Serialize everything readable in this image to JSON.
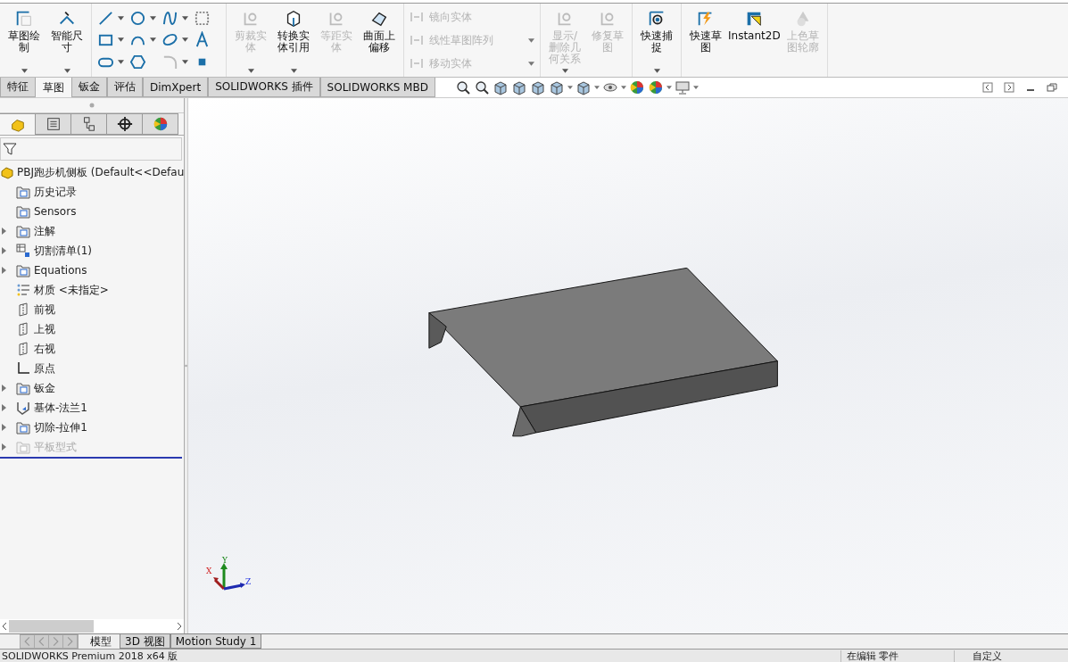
{
  "ribbon": {
    "groups": [
      {
        "kind": "big",
        "items": [
          {
            "label": "草图绘制",
            "disabled": false,
            "has_menu": true
          },
          {
            "label": "智能尺寸",
            "disabled": false,
            "has_menu": true
          }
        ]
      },
      {
        "kind": "grid",
        "items": [
          {
            "has_menu": true
          },
          {
            "has_menu": true
          },
          {
            "has_menu": true
          },
          {
            "has_menu": false
          },
          {
            "has_menu": true
          },
          {
            "has_menu": true
          },
          {
            "has_menu": true
          },
          {
            "has_menu": false
          },
          {
            "has_menu": true
          },
          {
            "has_menu": false
          },
          {
            "has_menu": true
          },
          {
            "has_menu": false
          }
        ]
      },
      {
        "kind": "big",
        "items": [
          {
            "label": "剪裁实体",
            "disabled": true,
            "has_menu": true
          },
          {
            "label": "转换实体引用",
            "disabled": false,
            "has_menu": true
          },
          {
            "label": "等距实体",
            "disabled": true,
            "has_menu": false
          },
          {
            "label": "曲面上偏移",
            "disabled": false,
            "has_menu": false
          }
        ]
      },
      {
        "kind": "list",
        "items": [
          {
            "label": "镜向实体",
            "disabled": true,
            "has_menu": false
          },
          {
            "label": "线性草图阵列",
            "disabled": true,
            "has_menu": true
          },
          {
            "label": "移动实体",
            "disabled": true,
            "has_menu": true
          }
        ]
      },
      {
        "kind": "big",
        "items": [
          {
            "label": "显示/删除几何关系",
            "disabled": true,
            "has_menu": true
          },
          {
            "label": "修复草图",
            "disabled": true,
            "has_menu": false
          }
        ]
      },
      {
        "kind": "big",
        "items": [
          {
            "label": "快速捕捉",
            "disabled": false,
            "has_menu": true
          }
        ]
      },
      {
        "kind": "big",
        "items": [
          {
            "label": "快速草图",
            "disabled": false,
            "has_menu": false
          },
          {
            "label": "Instant2D",
            "disabled": false,
            "has_menu": false
          },
          {
            "label": "上色草图轮廓",
            "disabled": true,
            "has_menu": false
          }
        ]
      }
    ]
  },
  "tabs": [
    {
      "label": "特征",
      "selected": false
    },
    {
      "label": "草图",
      "selected": true
    },
    {
      "label": "钣金",
      "selected": false
    },
    {
      "label": "评估",
      "selected": false
    },
    {
      "label": "DimXpert",
      "selected": false
    },
    {
      "label": "SOLIDWORKS 插件",
      "selected": false
    },
    {
      "label": "SOLIDWORKS MBD",
      "selected": false
    }
  ],
  "panel_tabs": [
    {
      "selected": true
    },
    {
      "selected": false
    },
    {
      "selected": false
    },
    {
      "selected": false
    },
    {
      "selected": false
    }
  ],
  "tree": {
    "label": "PBJ跑步机侧板  (Default<<Defau",
    "children": [
      {
        "label": "历史记录",
        "expandable": false,
        "disabled": false
      },
      {
        "label": "Sensors",
        "expandable": false,
        "disabled": false
      },
      {
        "label": "注解",
        "expandable": true,
        "disabled": false
      },
      {
        "label": "切割清单(1)",
        "expandable": true,
        "disabled": false
      },
      {
        "label": "Equations",
        "expandable": true,
        "disabled": false
      },
      {
        "label": "材质 <未指定>",
        "expandable": false,
        "disabled": false
      },
      {
        "label": "前视",
        "expandable": false,
        "disabled": false
      },
      {
        "label": "上视",
        "expandable": false,
        "disabled": false
      },
      {
        "label": "右视",
        "expandable": false,
        "disabled": false
      },
      {
        "label": "原点",
        "expandable": false,
        "disabled": false
      },
      {
        "label": "钣金",
        "expandable": true,
        "disabled": false
      },
      {
        "label": "基体-法兰1",
        "expandable": true,
        "disabled": false
      },
      {
        "label": "切除-拉伸1",
        "expandable": true,
        "disabled": false
      },
      {
        "label": "平板型式",
        "expandable": true,
        "disabled": true
      }
    ]
  },
  "triad": {
    "x": "X",
    "y": "Y",
    "z": "Z"
  },
  "bottom_tabs": [
    {
      "label": "模型",
      "selected": true
    },
    {
      "label": "3D 视图",
      "selected": false
    },
    {
      "label": "Motion Study 1",
      "selected": false
    }
  ],
  "status_bar": [
    "SOLIDWORKS Premium 2018 x64 版",
    "在编辑 零件",
    "自定义"
  ]
}
